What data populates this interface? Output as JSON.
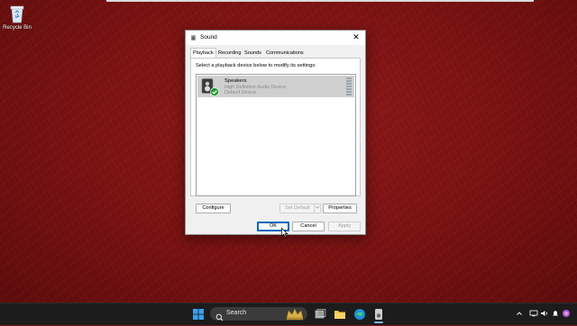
{
  "desktop": {
    "icons": [
      {
        "label": "Recycle Bin",
        "icon": "recycle-bin-icon"
      }
    ]
  },
  "dialog": {
    "title": "Sound",
    "close_glyph": "✕",
    "tabs": [
      "Playback",
      "Recording",
      "Sounds",
      "Communications"
    ],
    "active_tab": "Playback",
    "instruction": "Select a playback device below to modify its settings:",
    "devices": [
      {
        "name": "Speakers",
        "description": "High Definition Audio Device",
        "status": "Default Device",
        "icon": "speaker-icon",
        "badge": "default-checkmark-icon"
      }
    ],
    "buttons": {
      "configure": "Configure",
      "set_default": "Set Default",
      "properties": "Properties",
      "ok": "OK",
      "cancel": "Cancel",
      "apply": "Apply"
    }
  },
  "taskbar": {
    "search_label": "Search",
    "apps": [
      "windows-start-icon",
      "search-icon",
      "widgets-icon",
      "task-view-icon",
      "file-explorer-icon",
      "edge-icon",
      "sound-app-icon"
    ],
    "tray": [
      "chevron-up-icon",
      "network-icon",
      "volume-icon"
    ]
  },
  "colors": {
    "wallpaper": "#7d1414",
    "taskbar": "#1c1c1c",
    "selection": "#cfcfcf",
    "accent": "#0067c0",
    "check": "#2b9a3a"
  }
}
